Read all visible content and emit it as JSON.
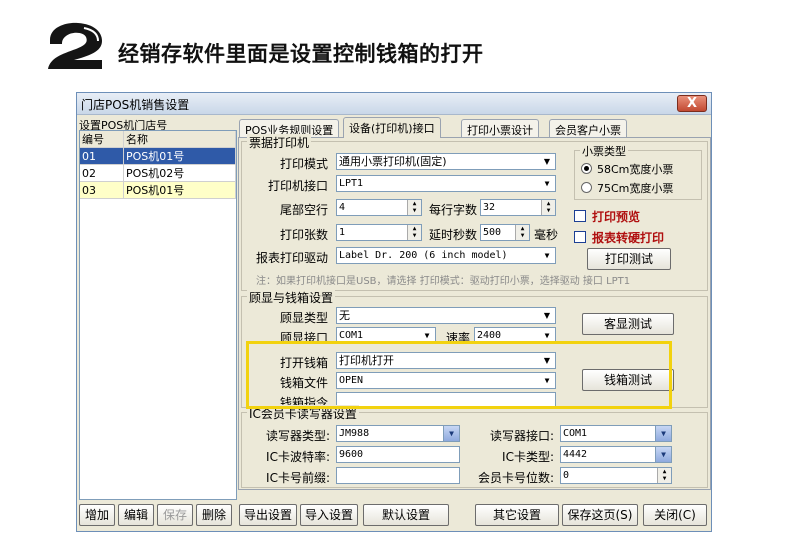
{
  "heading": "经销存软件里面是设置控制钱箱的打开",
  "window": {
    "title": "门店POS机销售设置",
    "close_label": "X"
  },
  "store_list": {
    "label": "设置POS机门店号",
    "columns": [
      "编号",
      "名称"
    ],
    "rows": [
      {
        "id": "01",
        "name": "POS机01号"
      },
      {
        "id": "02",
        "name": "POS机02号"
      },
      {
        "id": "03",
        "name": "POS机01号"
      }
    ]
  },
  "tabs": [
    "POS业务规则设置",
    "设备(打印机)接口",
    "打印小票设计",
    "会员客户小票"
  ],
  "receipt_printer": {
    "group_title": "票据打印机",
    "print_mode_label": "打印模式",
    "print_mode_value": "通用小票打印机(固定)",
    "port_label": "打印机接口",
    "port_value": "LPT1",
    "tail_lines_label": "尾部空行",
    "tail_lines_value": "4",
    "chars_per_line_label": "每行字数",
    "chars_per_line_value": "32",
    "copies_label": "打印张数",
    "copies_value": "1",
    "delay_label": "延时秒数",
    "delay_value": "500",
    "delay_unit": "毫秒",
    "report_driver_label": "报表打印驱动",
    "report_driver_value": "Label Dr. 200 (6 inch model)",
    "note": "注：如果打印机接口是USB，请选择 打印模式：驱动打印小票，选择驱动 接口 LPT1",
    "paper_type_title": "小票类型",
    "paper_58": "58Cm宽度小票",
    "paper_75": "75Cm宽度小票",
    "preview_label": "打印预览",
    "report_hard_print_label": "报表转硬打印",
    "test_print_label": "打印测试"
  },
  "display_drawer": {
    "group_title": "顾显与钱箱设置",
    "display_type_label": "顾显类型",
    "display_type_value": "无",
    "display_port_label": "顾显接口",
    "display_port_value": "COM1",
    "baud_label": "速率",
    "baud_value": "2400",
    "display_test_label": "客显测试",
    "open_drawer_label": "打开钱箱",
    "open_drawer_value": "打印机打开",
    "drawer_file_label": "钱箱文件",
    "drawer_file_value": "OPEN",
    "drawer_cmd_label": "钱箱指令",
    "drawer_cmd_value": "",
    "drawer_test_label": "钱箱测试"
  },
  "ic_reader": {
    "group_title": "IC会员卡读写器设置",
    "reader_type_label": "读写器类型:",
    "reader_type_value": "JM988",
    "reader_port_label": "读写器接口:",
    "reader_port_value": "COM1",
    "baud_label": "IC卡波特率:",
    "baud_value": "9600",
    "card_type_label": "IC卡类型:",
    "card_type_value": "4442",
    "prefix_label": "IC卡号前缀:",
    "prefix_value": "",
    "digits_label": "会员卡号位数:",
    "digits_value": "0"
  },
  "bottom_buttons": {
    "add": "增加",
    "edit": "编辑",
    "save": "保存",
    "delete": "删除",
    "export": "导出设置",
    "import": "导入设置",
    "default": "默认设置",
    "other": "其它设置",
    "save_page": "保存这页(S)",
    "close": "关闭(C)"
  }
}
